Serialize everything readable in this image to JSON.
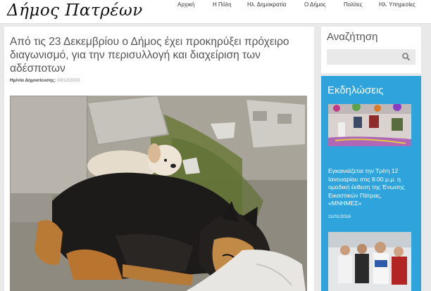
{
  "header": {
    "logo_text": "Δήμος Πατρέων",
    "nav": [
      "Αρχική",
      "Η Πόλη",
      "Ηλ. Δημοκρατία",
      "Ο Δήμος",
      "Πολίτες",
      "Ηλ. Υπηρεσίες"
    ]
  },
  "article": {
    "title": "Από τις 23 Δεκεμβρίου ο Δήμος έχει προκηρύξει πρόχειρο διαγωνισμό, για την περισυλλογή και διαχείριση των αδέσποτων",
    "date_label": "Ημ/νία Δημοσίευσης:",
    "date_value": "30/12/2015"
  },
  "sidebar": {
    "search_title": "Αναζήτηση",
    "search_placeholder": "",
    "events_title": "Εκδηλώσεις",
    "events": [
      {
        "text": "Εγκαινιάζεται την Τρίτη 12 Ιανουαρίου στις 8:00 μ.μ. η ομαδική έκθεση της Ένωσης Εικαστικών Πάτρας, «ΜΝΗΜΕΣ»",
        "date": "11/01/2016"
      }
    ]
  },
  "colors": {
    "accent": "#2ea3dc",
    "background": "#e9e9e9",
    "title_text": "#555555"
  }
}
